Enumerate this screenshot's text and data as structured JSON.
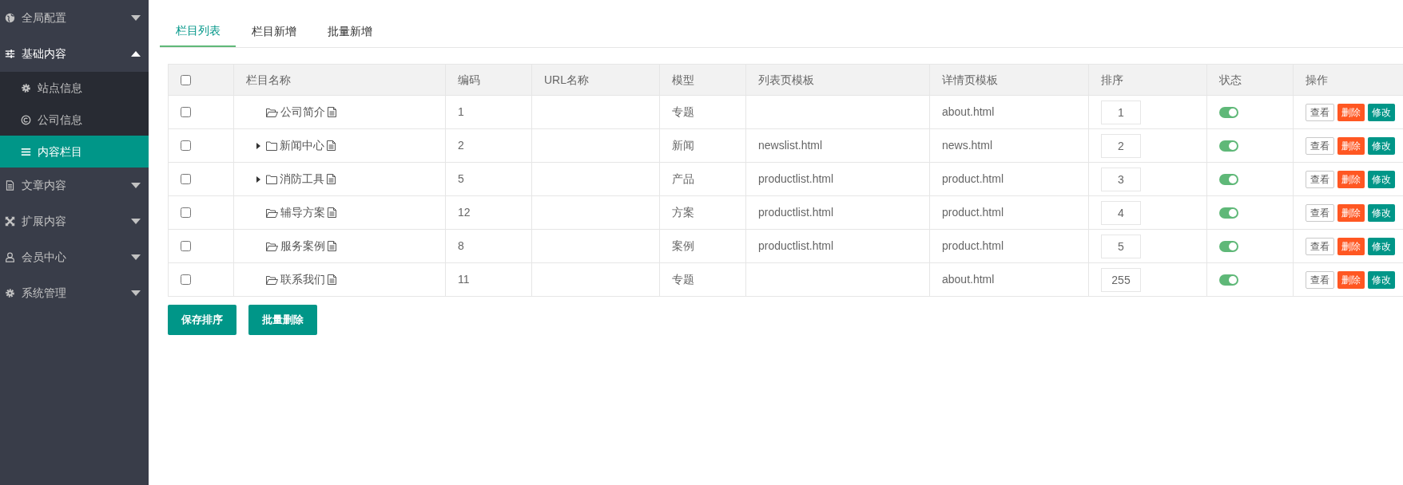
{
  "sidebar": {
    "items": [
      {
        "label": "全局配置",
        "expanded": false,
        "selected": false
      },
      {
        "label": "基础内容",
        "expanded": true,
        "selected": false,
        "children": [
          {
            "label": "站点信息",
            "selected": false
          },
          {
            "label": "公司信息",
            "selected": false
          },
          {
            "label": "内容栏目",
            "selected": true
          }
        ]
      },
      {
        "label": "文章内容",
        "expanded": false,
        "selected": false
      },
      {
        "label": "扩展内容",
        "expanded": false,
        "selected": false
      },
      {
        "label": "会员中心",
        "expanded": false,
        "selected": false
      },
      {
        "label": "系统管理",
        "expanded": false,
        "selected": false
      }
    ]
  },
  "tabs": [
    {
      "label": "栏目列表",
      "selected": true
    },
    {
      "label": "栏目新增",
      "selected": false
    },
    {
      "label": "批量新增",
      "selected": false
    }
  ],
  "table": {
    "select_all": {
      "checked": false
    },
    "columns": [
      "栏目名称",
      "编码",
      "URL名称",
      "模型",
      "列表页模板",
      "详情页模板",
      "排序",
      "状态",
      "操作"
    ],
    "rows": [
      {
        "checked": false,
        "expandable": false,
        "name": "公司简介",
        "code": "1",
        "model": "专题",
        "detail_template": "about.html",
        "sort": "1",
        "on": true,
        "actions": [
          "查看",
          "删除",
          "修改"
        ]
      },
      {
        "checked": false,
        "expandable": true,
        "name": "新闻中心",
        "code": "2",
        "model": "新闻",
        "list_template": "newslist.html",
        "detail_template": "news.html",
        "sort": "2",
        "on": true,
        "actions": [
          "查看",
          "删除",
          "修改"
        ]
      },
      {
        "checked": false,
        "expandable": true,
        "name": "消防工具",
        "code": "5",
        "model": "产品",
        "list_template": "productlist.html",
        "detail_template": "product.html",
        "sort": "3",
        "on": true,
        "actions": [
          "查看",
          "删除",
          "修改"
        ]
      },
      {
        "checked": false,
        "expandable": false,
        "name": "辅导方案",
        "code": "12",
        "model": "方案",
        "list_template": "productlist.html",
        "detail_template": "product.html",
        "sort": "4",
        "on": true,
        "actions": [
          "查看",
          "删除",
          "修改"
        ]
      },
      {
        "checked": false,
        "expandable": false,
        "name": "服务案例",
        "code": "8",
        "model": "案例",
        "list_template": "productlist.html",
        "detail_template": "product.html",
        "sort": "5",
        "on": true,
        "actions": [
          "查看",
          "删除",
          "修改"
        ]
      },
      {
        "checked": false,
        "expandable": false,
        "name": "联系我们",
        "code": "11",
        "model": "专题",
        "detail_template": "about.html",
        "sort": "255",
        "on": true,
        "actions": [
          "查看",
          "删除",
          "修改"
        ]
      }
    ]
  },
  "buttons": [
    "保存排序",
    "批量删除"
  ]
}
